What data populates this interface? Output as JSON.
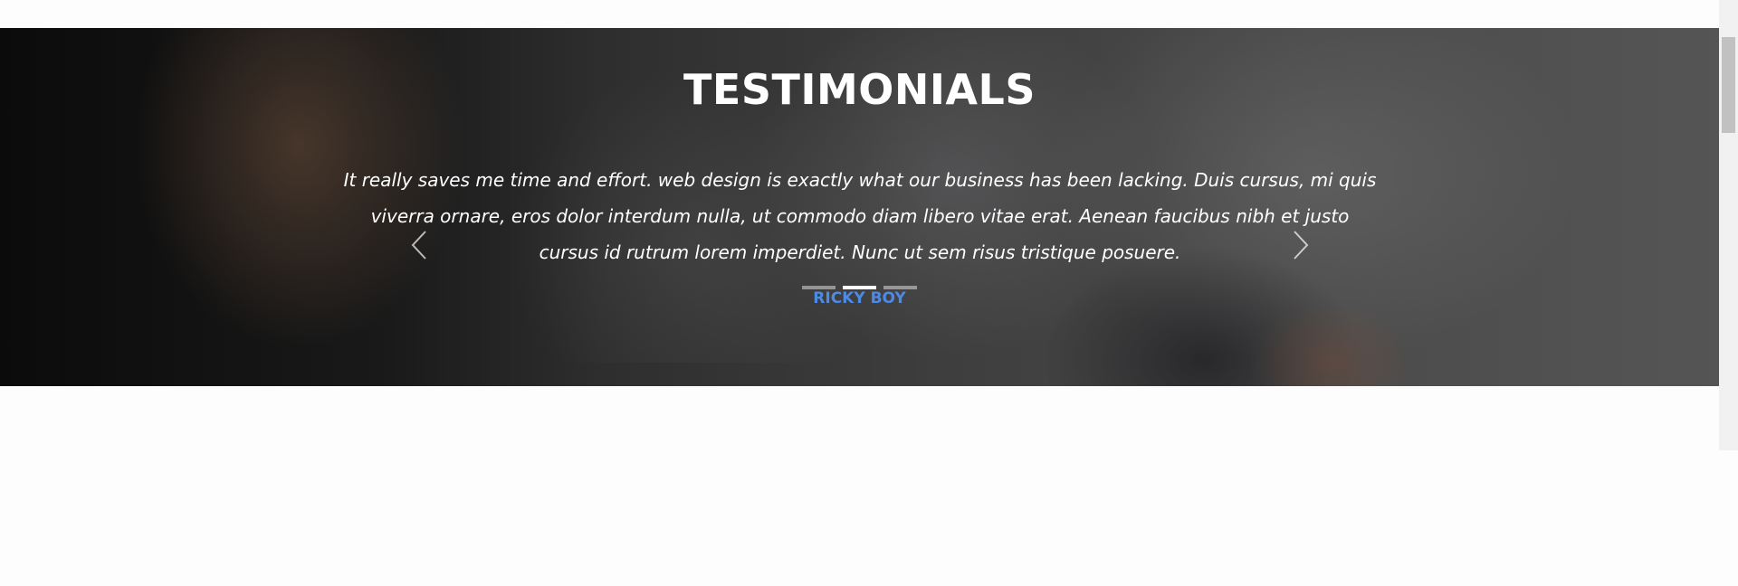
{
  "testimonials": {
    "title": "TESTIMONIALS",
    "quote": "It really saves me time and effort. web design is exactly what our business has been lacking. Duis cursus, mi quis viverra ornare, eros dolor interdum nulla, ut commodo diam libero vitae erat. Aenean faucibus nibh et justo cursus id rutrum lorem imperdiet. Nunc ut sem risus tristique posuere.",
    "author": "RICKY BOY",
    "slide_count": 3,
    "active_slide": 2,
    "prev_icon": "chevron-left-icon",
    "next_icon": "chevron-right-icon"
  },
  "colors": {
    "author": "#4c8ae6",
    "text": "#ffffff",
    "indicator_active": "#ffffff"
  }
}
